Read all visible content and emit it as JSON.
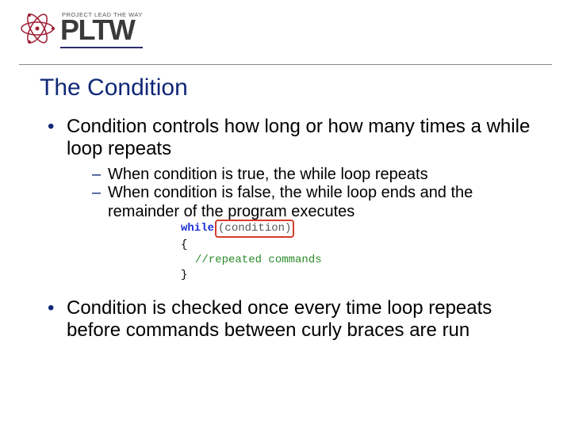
{
  "logo": {
    "tagline": "PROJECT LEAD THE WAY",
    "wordmark": "PLTW"
  },
  "slide": {
    "title": "The Condition",
    "bullets": {
      "b1": "Condition controls how long or how many times a while loop repeats",
      "sub1": "When condition is true, the while loop repeats",
      "sub2": "When condition is false, the while loop ends and the remainder of the program executes",
      "b2": "Condition is checked once every time loop repeats before commands between curly braces are run"
    },
    "code": {
      "kw_while": "while",
      "condition": "condition",
      "brace_open": "{",
      "comment": "//repeated commands",
      "brace_close": "}"
    }
  }
}
